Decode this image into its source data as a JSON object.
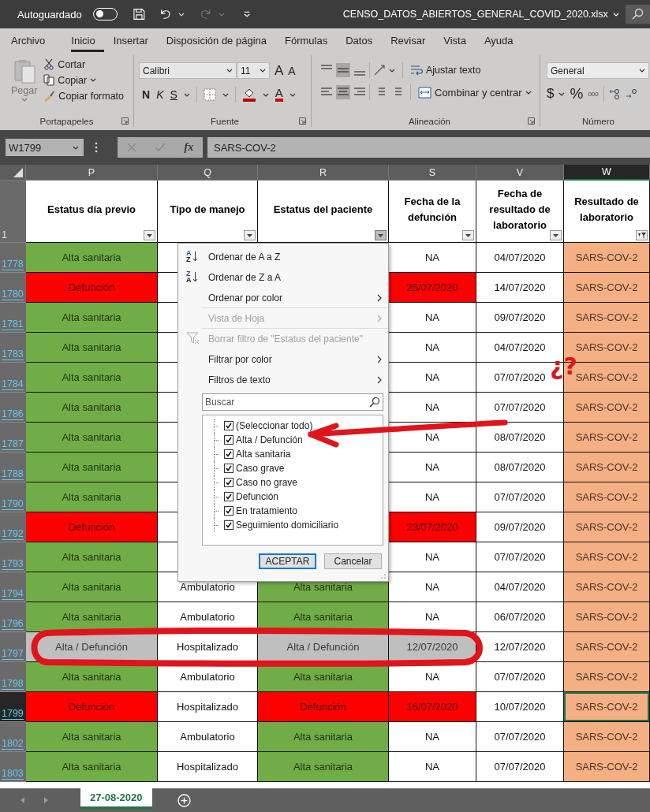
{
  "title_bar": {
    "autosave_label": "Autoguardado",
    "autosave_on": false,
    "file_name": "CENSO_DATOS_ABIERTOS_GENERAL_COVID_2020.xlsx"
  },
  "ribbon_tabs": [
    {
      "label": "Archivo",
      "selected": false
    },
    {
      "label": "Inicio",
      "selected": true
    },
    {
      "label": "Insertar",
      "selected": false
    },
    {
      "label": "Disposición de página",
      "selected": false
    },
    {
      "label": "Fórmulas",
      "selected": false
    },
    {
      "label": "Datos",
      "selected": false
    },
    {
      "label": "Revisar",
      "selected": false
    },
    {
      "label": "Vista",
      "selected": false
    },
    {
      "label": "Ayuda",
      "selected": false
    }
  ],
  "ribbon": {
    "clipboard": {
      "paste": "Pegar",
      "cut": "Cortar",
      "copy": "Copiar",
      "format_painter": "Copiar formato",
      "group": "Portapapeles"
    },
    "font": {
      "name": "Calibri",
      "size": "11",
      "grow": "A",
      "shrink": "A",
      "bold": "N",
      "italic": "K",
      "underline": "S",
      "font_color": "A",
      "group": "Fuente"
    },
    "alignment": {
      "wrap": "Ajustar texto",
      "merge": "Combinar y centrar",
      "group": "Alineación"
    },
    "number": {
      "format": "General",
      "currency": "$",
      "percent": "%",
      "thousands": "000",
      "group": "Número"
    }
  },
  "formula_bar": {
    "name_box": "W1799",
    "fx": "fx",
    "formula": "SARS-COV-2"
  },
  "sheet": {
    "header_row": "1",
    "columns": [
      {
        "letter": "P",
        "heading": "Estatus día previo",
        "selected": false,
        "menu_open": false,
        "filter_applied": false
      },
      {
        "letter": "Q",
        "heading": "Tipo de manejo",
        "selected": false,
        "menu_open": false,
        "filter_applied": false
      },
      {
        "letter": "R",
        "heading": "Estatus del paciente",
        "selected": false,
        "menu_open": true,
        "filter_applied": false
      },
      {
        "letter": "S",
        "heading": "Fecha de la defunción",
        "selected": false,
        "menu_open": false,
        "filter_applied": false
      },
      {
        "letter": "V",
        "heading": "Fecha de resultado de laboratorio",
        "selected": false,
        "menu_open": false,
        "filter_applied": false
      },
      {
        "letter": "W",
        "heading": "Resultado de laboratorio",
        "selected": true,
        "menu_open": false,
        "filter_applied": true
      }
    ],
    "rows": [
      {
        "number": "1778",
        "selected": false,
        "cells": [
          {
            "text": "Alta sanitaria",
            "color": "#70ad47"
          },
          null,
          null,
          {
            "text": "NA"
          },
          {
            "text": "04/07/2020"
          },
          {
            "text": "SARS-COV-2",
            "color": "#f4b084"
          }
        ]
      },
      {
        "number": "1780",
        "selected": false,
        "cells": [
          {
            "text": "Defunción",
            "color": "#ff0000"
          },
          null,
          null,
          {
            "text": "25/07/2020",
            "color": "#ff0000"
          },
          {
            "text": "14/07/2020"
          },
          {
            "text": "SARS-COV-2",
            "color": "#f4b084"
          }
        ]
      },
      {
        "number": "1781",
        "selected": false,
        "cells": [
          {
            "text": "Alta sanitaria",
            "color": "#70ad47"
          },
          null,
          null,
          {
            "text": "NA"
          },
          {
            "text": "09/07/2020"
          },
          {
            "text": "SARS-COV-2",
            "color": "#f4b084"
          }
        ]
      },
      {
        "number": "1783",
        "selected": false,
        "cells": [
          {
            "text": "Alta sanitaria",
            "color": "#70ad47"
          },
          null,
          null,
          {
            "text": "NA"
          },
          {
            "text": "04/07/2020"
          },
          {
            "text": "SARS-COV-2",
            "color": "#f4b084"
          }
        ]
      },
      {
        "number": "1784",
        "selected": false,
        "cells": [
          {
            "text": "Alta sanitaria",
            "color": "#70ad47"
          },
          null,
          null,
          {
            "text": "NA"
          },
          {
            "text": "07/07/2020"
          },
          {
            "text": "SARS-COV-2",
            "color": "#f4b084"
          }
        ]
      },
      {
        "number": "1786",
        "selected": false,
        "cells": [
          {
            "text": "Alta sanitaria",
            "color": "#70ad47"
          },
          null,
          null,
          {
            "text": "NA"
          },
          {
            "text": "07/07/2020"
          },
          {
            "text": "SARS-COV-2",
            "color": "#f4b084"
          }
        ]
      },
      {
        "number": "1787",
        "selected": false,
        "cells": [
          {
            "text": "Alta sanitaria",
            "color": "#70ad47"
          },
          null,
          null,
          {
            "text": "NA"
          },
          {
            "text": "08/07/2020"
          },
          {
            "text": "SARS-COV-2",
            "color": "#f4b084"
          }
        ]
      },
      {
        "number": "1788",
        "selected": false,
        "cells": [
          {
            "text": "Alta sanitaria",
            "color": "#70ad47"
          },
          null,
          null,
          {
            "text": "NA"
          },
          {
            "text": "08/07/2020"
          },
          {
            "text": "SARS-COV-2",
            "color": "#f4b084"
          }
        ]
      },
      {
        "number": "1790",
        "selected": false,
        "cells": [
          {
            "text": "Alta sanitaria",
            "color": "#70ad47"
          },
          null,
          null,
          {
            "text": "NA"
          },
          {
            "text": "07/07/2020"
          },
          {
            "text": "SARS-COV-2",
            "color": "#f4b084"
          }
        ]
      },
      {
        "number": "1792",
        "selected": false,
        "cells": [
          {
            "text": "Defunción",
            "color": "#ff0000"
          },
          null,
          null,
          {
            "text": "23/07/2020",
            "color": "#ff0000"
          },
          {
            "text": "09/07/2020"
          },
          {
            "text": "SARS-COV-2",
            "color": "#f4b084"
          }
        ]
      },
      {
        "number": "1793",
        "selected": false,
        "cells": [
          {
            "text": "Alta sanitaria",
            "color": "#70ad47"
          },
          null,
          null,
          {
            "text": "NA"
          },
          {
            "text": "07/07/2020"
          },
          {
            "text": "SARS-COV-2",
            "color": "#f4b084"
          }
        ]
      },
      {
        "number": "1794",
        "selected": false,
        "cells": [
          {
            "text": "Alta sanitaria",
            "color": "#70ad47"
          },
          {
            "text": "Ambulatorio"
          },
          {
            "text": "Alta sanitaria",
            "color": "#70ad47"
          },
          {
            "text": "NA"
          },
          {
            "text": "04/07/2020"
          },
          {
            "text": "SARS-COV-2",
            "color": "#f4b084"
          }
        ]
      },
      {
        "number": "1796",
        "selected": false,
        "cells": [
          {
            "text": "Alta sanitaria",
            "color": "#70ad47"
          },
          {
            "text": "Ambulatorio"
          },
          {
            "text": "Alta sanitaria",
            "color": "#70ad47"
          },
          {
            "text": "NA"
          },
          {
            "text": "06/07/2020"
          },
          {
            "text": "SARS-COV-2",
            "color": "#f4b084"
          }
        ]
      },
      {
        "number": "1797",
        "selected": false,
        "cells": [
          {
            "text": "Alta / Defunción",
            "color": "#bfbfbf"
          },
          {
            "text": "Hospitalizado"
          },
          {
            "text": "Alta / Defunción",
            "color": "#bfbfbf"
          },
          {
            "text": "12/07/2020",
            "color": "#bfbfbf"
          },
          {
            "text": "12/07/2020"
          },
          {
            "text": "SARS-COV-2",
            "color": "#f4b084"
          }
        ]
      },
      {
        "number": "1798",
        "selected": false,
        "cells": [
          {
            "text": "Alta sanitaria",
            "color": "#70ad47"
          },
          {
            "text": "Ambulatorio"
          },
          {
            "text": "Alta sanitaria",
            "color": "#70ad47"
          },
          {
            "text": "NA"
          },
          {
            "text": "07/07/2020"
          },
          {
            "text": "SARS-COV-2",
            "color": "#f4b084"
          }
        ]
      },
      {
        "number": "1799",
        "selected": true,
        "cells": [
          {
            "text": "Defunción",
            "color": "#ff0000"
          },
          {
            "text": "Hospitalizado"
          },
          {
            "text": "Defunción",
            "color": "#ff0000"
          },
          {
            "text": "16/07/2020",
            "color": "#ff0000"
          },
          {
            "text": "10/07/2020"
          },
          {
            "text": "SARS-COV-2",
            "color": "#f4b084"
          }
        ]
      },
      {
        "number": "1802",
        "selected": false,
        "cells": [
          {
            "text": "Alta sanitaria",
            "color": "#70ad47"
          },
          {
            "text": "Ambulatorio"
          },
          {
            "text": "Alta sanitaria",
            "color": "#70ad47"
          },
          {
            "text": "NA"
          },
          {
            "text": "07/07/2020"
          },
          {
            "text": "SARS-COV-2",
            "color": "#f4b084"
          }
        ]
      },
      {
        "number": "1803",
        "selected": false,
        "cells": [
          {
            "text": "Alta sanitaria",
            "color": "#70ad47"
          },
          {
            "text": "Hospitalizado"
          },
          {
            "text": "Alta sanitaria",
            "color": "#70ad47"
          },
          {
            "text": "NA"
          },
          {
            "text": "07/07/2020"
          },
          {
            "text": "SARS-COV-2",
            "color": "#f4b084"
          }
        ]
      }
    ]
  },
  "filter_menu": {
    "items": [
      {
        "label": "Ordenar de A a Z",
        "kind": "sort",
        "icon_top": "A",
        "icon_bottom": "Z",
        "disabled": false,
        "submenu": false
      },
      {
        "label": "Ordenar de Z a A",
        "kind": "sort",
        "icon_top": "Z",
        "icon_bottom": "A",
        "disabled": false,
        "submenu": false
      },
      {
        "label": "Ordenar por color",
        "kind": "plain",
        "disabled": false,
        "submenu": true
      },
      {
        "label": "Vista de Hoja",
        "kind": "plain",
        "disabled": true,
        "submenu": true
      },
      {
        "label": "Borrar filtro de \"Estatus del paciente\"",
        "kind": "clear-filter",
        "disabled": true,
        "submenu": false
      },
      {
        "label": "Filtrar por color",
        "kind": "plain",
        "disabled": false,
        "submenu": true
      },
      {
        "label": "Filtros de texto",
        "kind": "plain",
        "disabled": false,
        "submenu": true
      }
    ],
    "search_placeholder": "Buscar",
    "values": [
      {
        "label": "(Seleccionar todo)",
        "checked": true
      },
      {
        "label": "Alta / Defunción",
        "checked": true
      },
      {
        "label": "Alta sanitaria",
        "checked": true
      },
      {
        "label": "Caso grave",
        "checked": true
      },
      {
        "label": "Caso no grave",
        "checked": true
      },
      {
        "label": "Defunción",
        "checked": true
      },
      {
        "label": "En tratamiento",
        "checked": true
      },
      {
        "label": "Seguimiento domiciliario",
        "checked": true
      }
    ],
    "ok": "ACEPTAR",
    "cancel": "Cancelar"
  },
  "sheet_tabs": [
    {
      "label": "27-08-2020",
      "selected": true
    }
  ],
  "annotation": {
    "text": "¿?"
  }
}
